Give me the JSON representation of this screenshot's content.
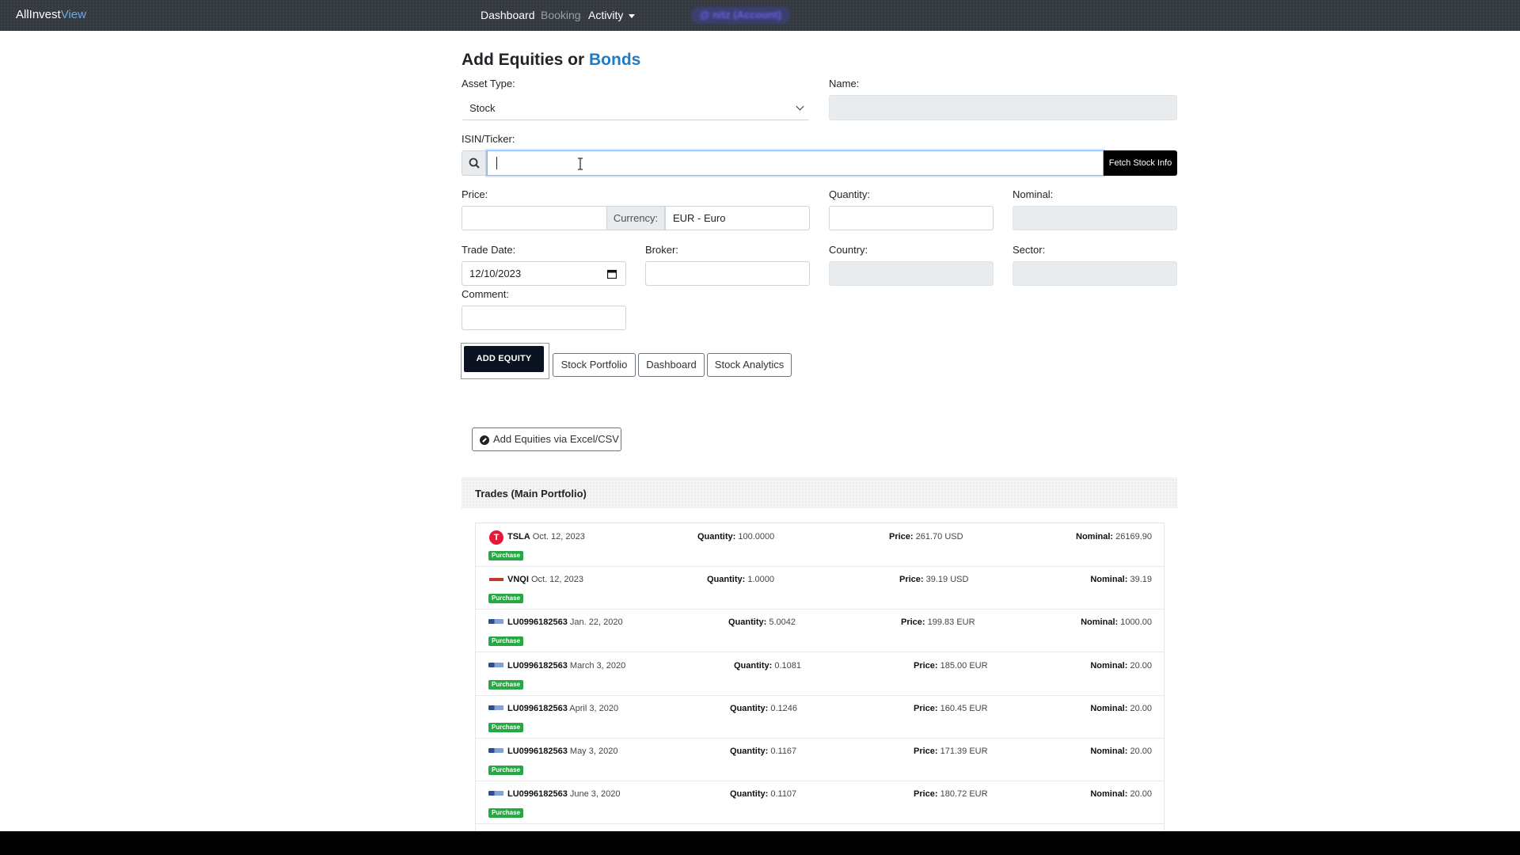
{
  "navbar": {
    "brand_main": "AllInvest",
    "brand_accent": "View",
    "links": [
      "Dashboard",
      "Booking",
      "Activity"
    ],
    "account": "@ nitz (Account)"
  },
  "form": {
    "title_main": "Add Equities or ",
    "title_accent": "Bonds",
    "asset_type_label": "Asset Type:",
    "asset_type_value": "Stock",
    "name_label": "Name:",
    "isin_label": "ISIN/Ticker:",
    "fetch_label": "Fetch Stock Info",
    "price_label": "Price:",
    "currency_label": "Currency:",
    "currency_value": "EUR - Euro",
    "quantity_label": "Quantity:",
    "nominal_label": "Nominal:",
    "trade_date_label": "Trade Date:",
    "trade_date_value": "12/10/2023",
    "broker_label": "Broker:",
    "country_label": "Country:",
    "sector_label": "Sector:",
    "comment_label": "Comment:"
  },
  "actions": {
    "add_equity": "ADD EQUITY",
    "stock_portfolio": "Stock Portfolio",
    "dashboard": "Dashboard",
    "stock_analytics": "Stock Analytics",
    "csv": "Add Equities via Excel/CSV"
  },
  "trades": {
    "header": "Trades (Main Portfolio)",
    "labels": {
      "quantity": "Quantity:",
      "price": "Price:",
      "nominal": "Nominal:",
      "badge": "Purchase"
    },
    "rows": [
      {
        "logo": "tesla",
        "ticker": "TSLA",
        "date": "Oct. 12, 2023",
        "quantity": "100.0000",
        "price": "261.70 USD",
        "nominal": "26169.90"
      },
      {
        "logo": "vnq",
        "ticker": "VNQI",
        "date": "Oct. 12, 2023",
        "quantity": "1.0000",
        "price": "39.19 USD",
        "nominal": "39.19"
      },
      {
        "logo": "amundi",
        "ticker": "LU0996182563",
        "date": "Jan. 22, 2020",
        "quantity": "5.0042",
        "price": "199.83 EUR",
        "nominal": "1000.00"
      },
      {
        "logo": "amundi",
        "ticker": "LU0996182563",
        "date": "March 3, 2020",
        "quantity": "0.1081",
        "price": "185.00 EUR",
        "nominal": "20.00"
      },
      {
        "logo": "amundi",
        "ticker": "LU0996182563",
        "date": "April 3, 2020",
        "quantity": "0.1246",
        "price": "160.45 EUR",
        "nominal": "20.00"
      },
      {
        "logo": "amundi",
        "ticker": "LU0996182563",
        "date": "May 3, 2020",
        "quantity": "0.1167",
        "price": "171.39 EUR",
        "nominal": "20.00"
      },
      {
        "logo": "amundi",
        "ticker": "LU0996182563",
        "date": "June 3, 2020",
        "quantity": "0.1107",
        "price": "180.72 EUR",
        "nominal": "20.00"
      }
    ]
  }
}
